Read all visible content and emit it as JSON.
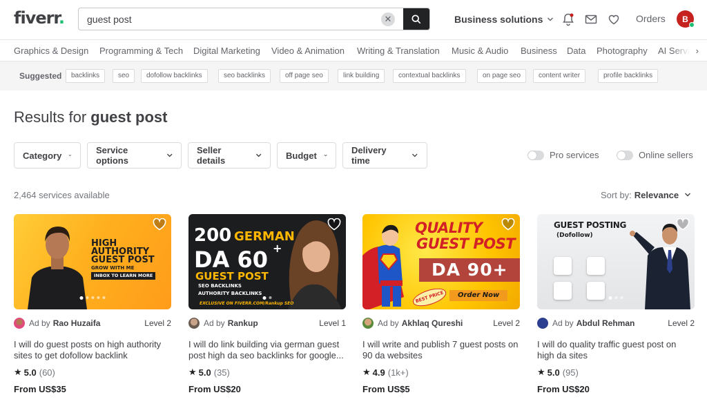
{
  "header": {
    "logo_text": "fiverr",
    "logo_dot": ".",
    "search_value": "guest post",
    "business_solutions": "Business solutions",
    "orders": "Orders",
    "avatar_letter": "B"
  },
  "categories": [
    "Graphics & Design",
    "Programming & Tech",
    "Digital Marketing",
    "Video & Animation",
    "Writing & Translation",
    "Music & Audio",
    "Business",
    "Data",
    "Photography",
    "AI Servi"
  ],
  "suggested": {
    "label": "Suggested",
    "chips": [
      "backlinks",
      "seo",
      "dofollow backlinks",
      "seo backlinks",
      "off page seo",
      "link building",
      "contextual backlinks",
      "on page seo",
      "content writer",
      "profile backlinks"
    ]
  },
  "results": {
    "prefix": "Results for ",
    "query": "guest post"
  },
  "filters": [
    "Category",
    "Service options",
    "Seller details",
    "Budget",
    "Delivery time"
  ],
  "toggles": [
    "Pro services",
    "Online sellers"
  ],
  "services_count": "2,464 services available",
  "sort": {
    "label": "Sort by:",
    "value": "Relevance"
  },
  "colors": {
    "brand_green": "#1dbf73",
    "avatar_red": "#c5221f",
    "text": "#404145"
  },
  "cards": [
    {
      "ad_by": "Ad by",
      "seller": "Rao Huzaifa",
      "level": "Level 2",
      "title": "I will do guest posts on high authority sites to get dofollow backlink",
      "rating": "5.0",
      "reviews": "(60)",
      "price": "From US$35",
      "art_lines": [
        "HIGH",
        "AUTHORITY",
        "GUEST POST",
        "GROW WITH ME",
        "INBOX TO LEARN MORE"
      ]
    },
    {
      "ad_by": "Ad by",
      "seller": "Rankup",
      "level": "Level 1",
      "title": "I will do link building via german guest post high da seo backlinks for google...",
      "rating": "5.0",
      "reviews": "(35)",
      "price": "From US$20",
      "art_lines": [
        "200",
        "GERMAN",
        "DA 60",
        "+",
        "GUEST POST",
        "SEO BACKLINKS",
        "AUTHORITY BACKLINKS",
        "EXCLUSIVE ON FIVERR.COM/Rankup SEO"
      ]
    },
    {
      "ad_by": "Ad by",
      "seller": "Akhlaq Qureshi",
      "level": "Level 2",
      "title": "I will write and publish 7 guest posts on 90 da websites",
      "rating": "4.9",
      "reviews": "(1k+)",
      "price": "From US$5",
      "art_lines": [
        "QUALITY",
        "GUEST POST",
        "DA 90+",
        "Order Now",
        "BEST PRICE"
      ]
    },
    {
      "ad_by": "Ad by",
      "seller": "Abdul Rehman",
      "level": "Level 2",
      "title": "I will do quality traffic guest post on high da sites",
      "rating": "5.0",
      "reviews": "(95)",
      "price": "From US$20",
      "art_lines": [
        "GUEST POSTING",
        "(Dofollow)"
      ]
    }
  ]
}
